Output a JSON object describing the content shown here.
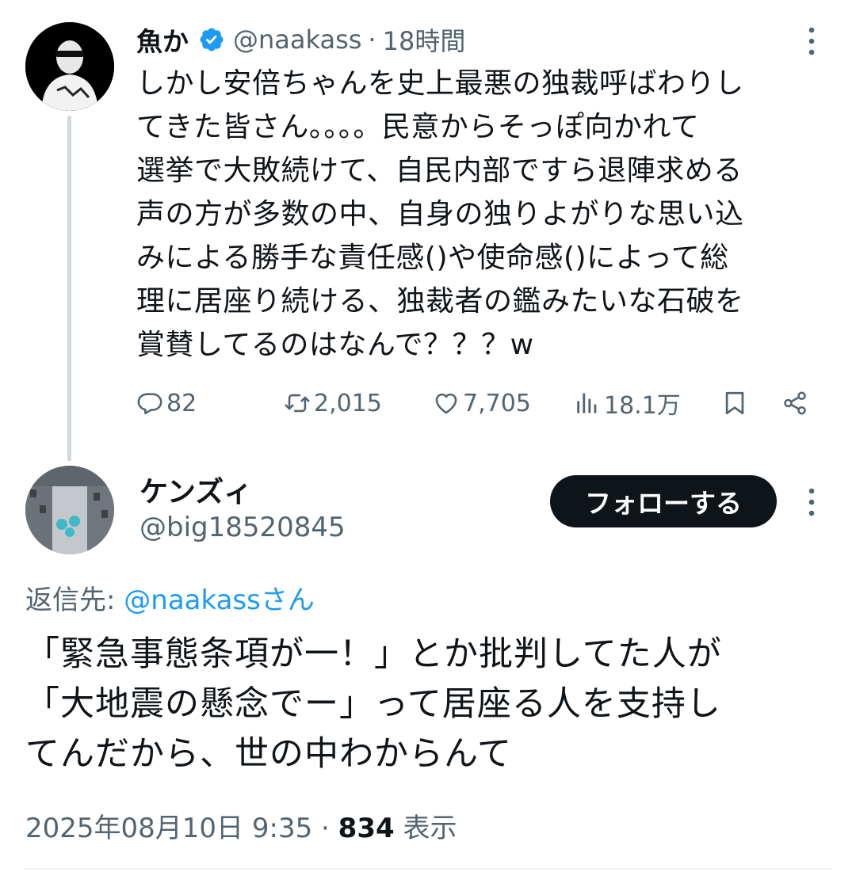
{
  "tweet": {
    "author_name": "魚か",
    "author_handle": "@naakass",
    "separator": "·",
    "time": "18時間",
    "text": "しかし安倍ちゃんを史上最悪の独裁呼ばわりし\nてきた皆さん。。。。民意からそっぽ向かれて\n選挙で大敗続けて、自民内部ですら退陣求める\n声の方が多数の中、自身の独りよがりな思い込\nみによる勝手な責任感()や使命感()によって総\n理に居座り続ける、独裁者の鑑みたいな石破を\n賞賛してるのはなんで？？？w",
    "stats": {
      "replies": "82",
      "retweets": "2,015",
      "likes": "7,705",
      "views": "18.1万"
    }
  },
  "reply": {
    "author_name": "ケンズィ",
    "author_handle": "@big18520845",
    "follow_label": "フォローする",
    "reply_to_label": "返信先: ",
    "reply_to_mention": "@naakassさん",
    "text": "「緊急事態条項が一！」とか批判してた人が\n「大地震の懸念でー」って居座る人を支持し\nてんだから、世の中わからんて",
    "datetime": "2025年08月10日 9:35",
    "separator": " · ",
    "views_count": "834",
    "views_label": " 表示"
  },
  "icons": {
    "verified": "verified-badge-icon",
    "reply": "reply-icon",
    "retweet": "retweet-icon",
    "like": "heart-icon",
    "views": "views-icon",
    "bookmark": "bookmark-icon",
    "share": "share-icon",
    "more": "more-icon"
  },
  "colors": {
    "accent": "#1d9bf0",
    "text": "#0f1419",
    "secondary": "#536471",
    "thread_line": "#cfd9de"
  }
}
